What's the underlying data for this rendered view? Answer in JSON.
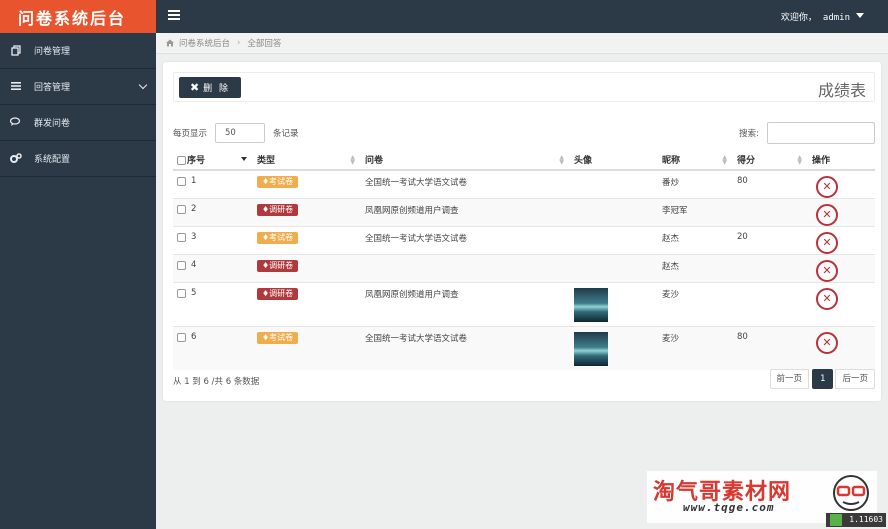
{
  "app": {
    "title": "问卷系统后台"
  },
  "topbar": {
    "welcome": "欢迎你，",
    "username": "admin"
  },
  "sidebar": {
    "items": [
      {
        "label": "问卷管理",
        "icon": "copy-icon"
      },
      {
        "label": "回答管理",
        "icon": "list-icon"
      },
      {
        "label": "群发问卷",
        "icon": "comments-icon"
      },
      {
        "label": "系统配置",
        "icon": "cogs-icon"
      }
    ]
  },
  "breadcrumb": {
    "home": "问卷系统后台",
    "current": "全部回答"
  },
  "toolbar": {
    "delete_label": "删 除",
    "title": "成绩表"
  },
  "length": {
    "prefix": "每页显示",
    "value": "50",
    "suffix": "条记录"
  },
  "search": {
    "label": "搜索:"
  },
  "table": {
    "headers": [
      "序号",
      "类型",
      "问卷",
      "头像",
      "昵称",
      "得分",
      "操作"
    ],
    "rows": [
      {
        "id": "1",
        "type": "考试卷",
        "kind": "exam",
        "survey": "全国统一考试大学语文试卷",
        "avatar": false,
        "nickname": "番炒",
        "score": "80"
      },
      {
        "id": "2",
        "type": "调研卷",
        "kind": "survey",
        "survey": "凤凰网原创频道用户调查",
        "avatar": false,
        "nickname": "李冠军",
        "score": ""
      },
      {
        "id": "3",
        "type": "考试卷",
        "kind": "exam",
        "survey": "全国统一考试大学语文试卷",
        "avatar": false,
        "nickname": "赵杰",
        "score": "20"
      },
      {
        "id": "4",
        "type": "调研卷",
        "kind": "survey",
        "survey": "",
        "avatar": false,
        "nickname": "赵杰",
        "score": ""
      },
      {
        "id": "5",
        "type": "调研卷",
        "kind": "survey",
        "survey": "凤凰网原创频道用户调查",
        "avatar": true,
        "nickname": "麦沙",
        "score": ""
      },
      {
        "id": "6",
        "type": "考试卷",
        "kind": "exam",
        "survey": "全国统一考试大学语文试卷",
        "avatar": true,
        "nickname": "麦沙",
        "score": "80"
      }
    ]
  },
  "footer": {
    "info": "从 1 到 6 /共 6 条数据",
    "prev": "前一页",
    "page": "1",
    "next": "后一页"
  },
  "watermark": {
    "line1": "淘气哥素材网",
    "line2": "www.tqge.com",
    "version": "1.11603"
  },
  "colors": {
    "brand": "#e8542e",
    "dark": "#2c3a48",
    "exam": "#f0ad4e",
    "survey": "#b0393d",
    "danger": "#b7323a"
  }
}
